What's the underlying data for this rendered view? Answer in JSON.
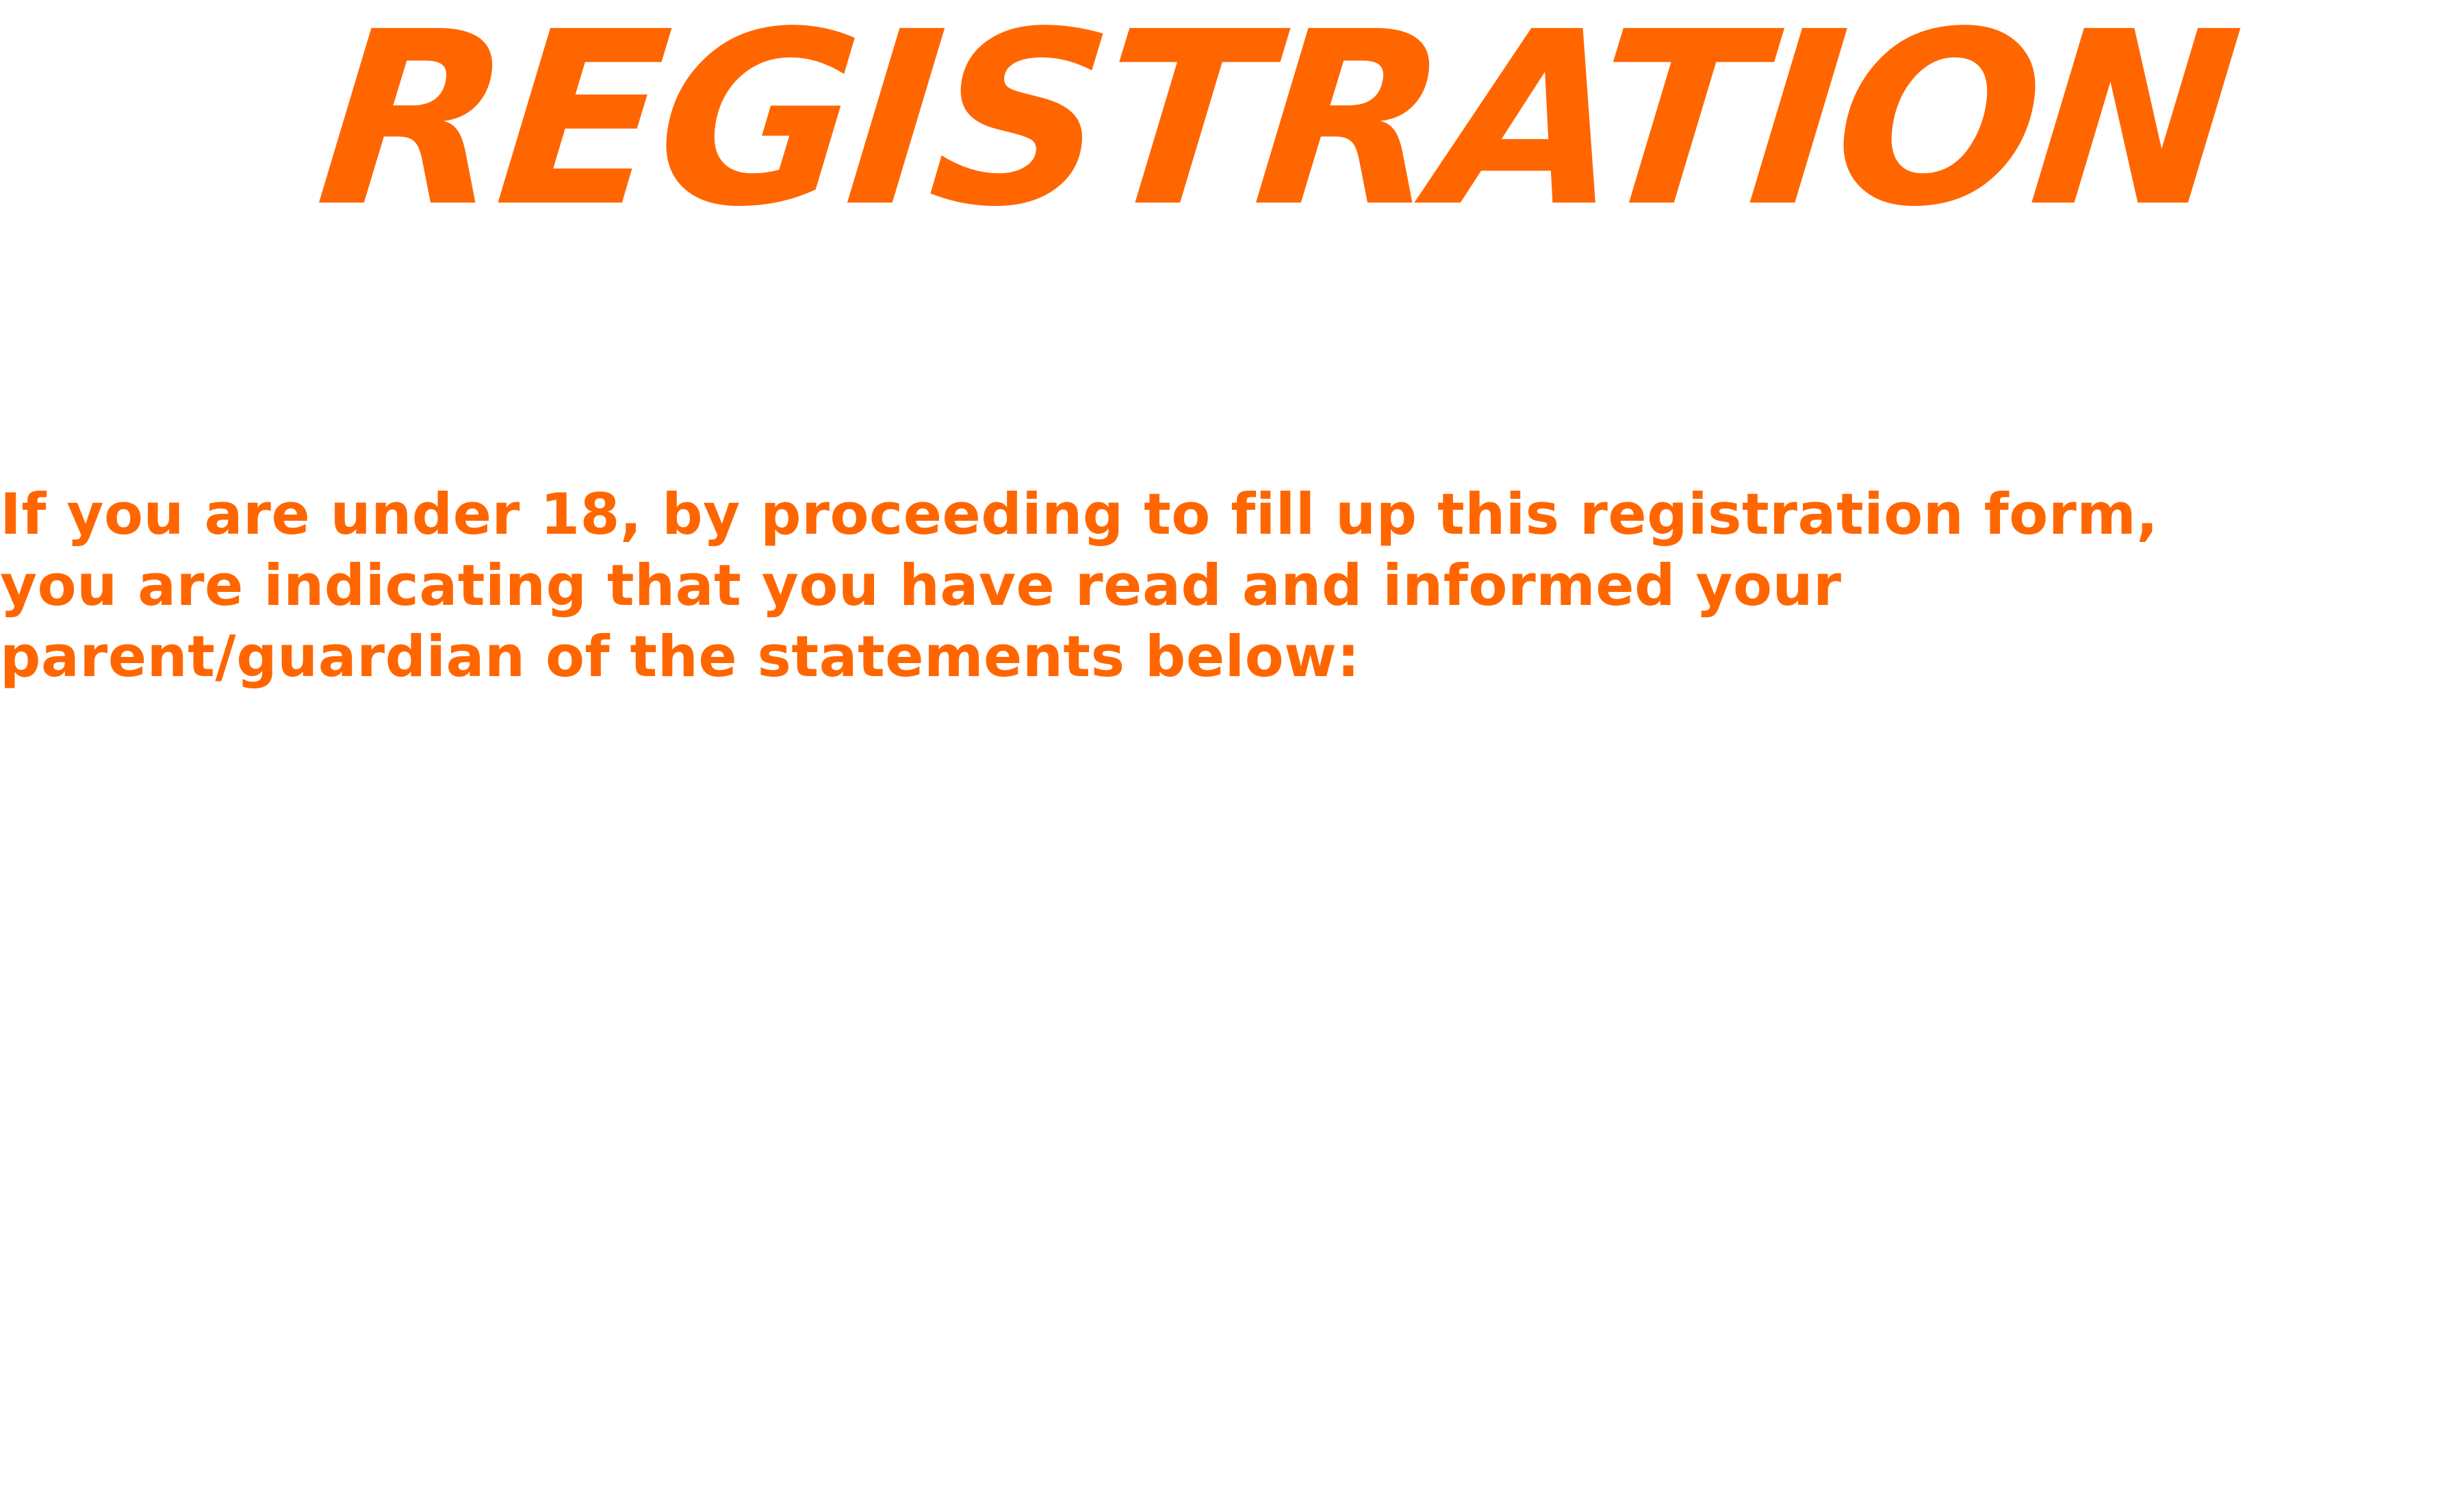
{
  "header": {
    "title": "REGISTRATION"
  },
  "notice": {
    "text": "If you are under 18, by proceeding to fill up this registration form, you are indicating that you have read and informed your parent/guardian of the statements below:"
  },
  "colors": {
    "accent": "#FF6600",
    "background": "#FFFFFF"
  }
}
